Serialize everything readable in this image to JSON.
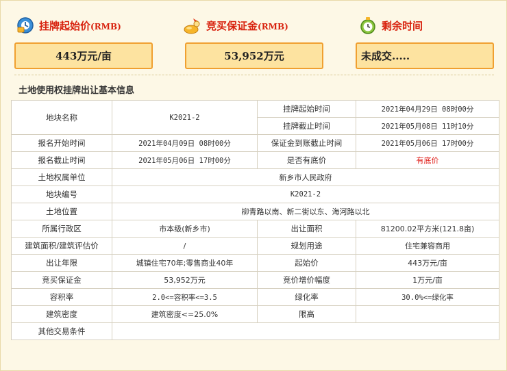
{
  "header": {
    "start_price_label": "挂牌起始价",
    "start_price_unit": "(RMB)",
    "deposit_label": "竞买保证金",
    "deposit_unit": "(RMB)",
    "remaining_label": "剩余时间"
  },
  "boxes": {
    "start_price": "443万元/亩",
    "deposit": "53,952万元",
    "remaining": "未成交....."
  },
  "section_title": "土地使用权挂牌出让基本信息",
  "table": {
    "r1": {
      "l1": "地块名称",
      "v1": "K2021-2",
      "l2a": "挂牌起始时间",
      "v2a": "2021年04月29日 08时00分",
      "l2b": "挂牌截止时间",
      "v2b": "2021年05月08日 11时10分"
    },
    "r2": {
      "l1": "报名开始时间",
      "v1": "2021年04月09日 08时00分",
      "l2": "保证金到账截止时间",
      "v2": "2021年05月06日 17时00分"
    },
    "r3": {
      "l1": "报名截止时间",
      "v1": "2021年05月06日 17时00分",
      "l2": "是否有底价",
      "v2": "有底价"
    },
    "r4": {
      "l1": "土地权属单位",
      "v1": "新乡市人民政府"
    },
    "r5": {
      "l1": "地块编号",
      "v1": "K2021-2"
    },
    "r6": {
      "l1": "土地位置",
      "v1": "柳青路以南、新二街以东、海河路以北"
    },
    "r7": {
      "l1": "所属行政区",
      "v1": "市本级(新乡市)",
      "l2": "出让面积",
      "v2": "81200.02平方米(121.8亩)"
    },
    "r8": {
      "l1": "建筑面积/建筑评估价",
      "v1": "/",
      "l2": "规划用途",
      "v2": "住宅兼容商用"
    },
    "r9": {
      "l1": "出让年限",
      "v1": "城镇住宅70年;零售商业40年",
      "l2": "起始价",
      "v2": "443万元/亩"
    },
    "r10": {
      "l1": "竞买保证金",
      "v1": "53,952万元",
      "l2": "竞价增价幅度",
      "v2": "1万元/亩"
    },
    "r11": {
      "l1": "容积率",
      "v1": "2.0<=容积率<=3.5",
      "l2": "绿化率",
      "v2": "30.0%<=绿化率"
    },
    "r12": {
      "l1": "建筑密度",
      "v1": "建筑密度<=25.0%",
      "l2": "限高",
      "v2": ""
    },
    "r13": {
      "l1": "其他交易条件",
      "v1": ""
    }
  },
  "colors": {
    "accent_red": "#d8220e",
    "box_bg": "#fde3a0",
    "box_border": "#f0a030",
    "page_bg": "#fdf8e6"
  }
}
